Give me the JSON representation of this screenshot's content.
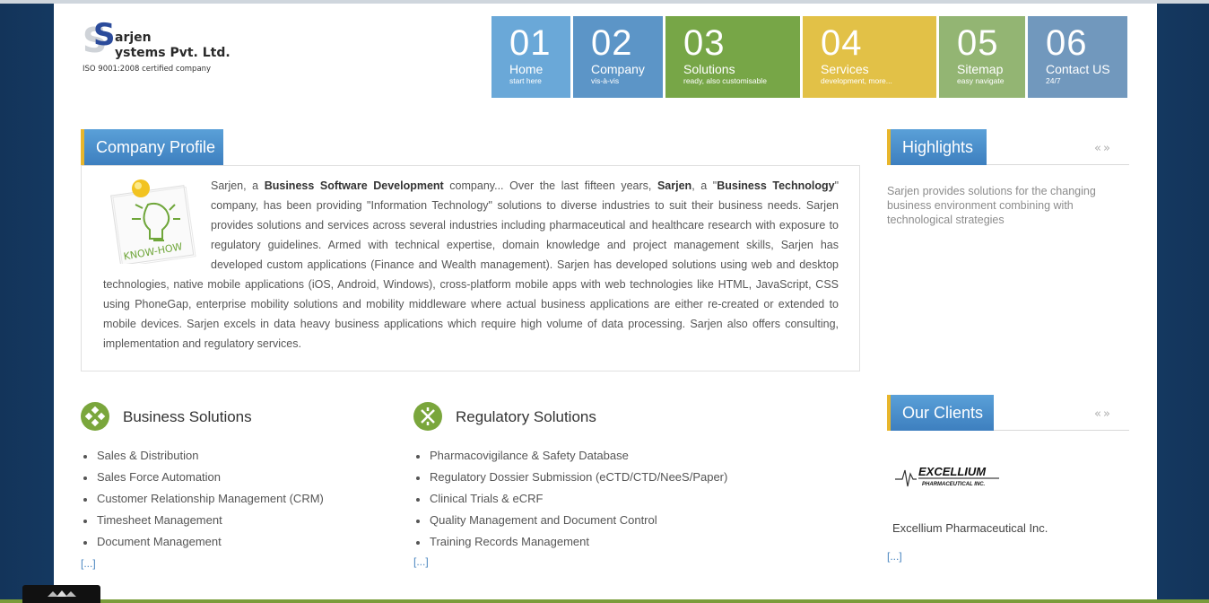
{
  "logo": {
    "name_line1": "arjen",
    "name_line2": "ystems Pvt. Ltd.",
    "tagline": "ISO 9001:2008 certified company"
  },
  "nav": [
    {
      "num": "01",
      "label": "Home",
      "sub": "start here",
      "color": "#6aa8d8"
    },
    {
      "num": "02",
      "label": "Company",
      "sub": "vis-à-vis",
      "color": "#5c95c7"
    },
    {
      "num": "03",
      "label": "Solutions",
      "sub": "ready, also customisable",
      "color": "#77a647"
    },
    {
      "num": "04",
      "label": "Services",
      "sub": "development, more...",
      "color": "#e2c147"
    },
    {
      "num": "05",
      "label": "Sitemap",
      "sub": "easy navigate",
      "color": "#93b573"
    },
    {
      "num": "06",
      "label": "Contact US",
      "sub": "24/7",
      "color": "#7198bd"
    }
  ],
  "profile": {
    "heading": "Company Profile",
    "image_label": "KNOW-HOW",
    "p1": "Sarjen, a ",
    "b1": "Business Software Development",
    "p2": " company... Over the last fifteen years, ",
    "b2": "Sarjen",
    "p3": ", a \"",
    "b3": "Business Technology",
    "p4": "\" company, has been providing \"Information Technology\" solutions to diverse industries to suit their business needs. Sarjen provides solutions and services across several industries including pharmaceutical and healthcare research with exposure to regulatory guidelines. Armed with technical expertise, domain knowledge and project management skills, Sarjen has developed custom applications (Finance and Wealth management). Sarjen has developed solutions using web and desktop technologies, native mobile applications (iOS, Android, Windows), cross-platform mobile apps with web technologies like HTML, JavaScript, CSS using PhoneGap, enterprise mobility solutions and mobility middleware where actual business applications are either re-created or extended to mobile devices. Sarjen excels in data heavy business applications which require high volume of data processing. Sarjen also offers consulting, implementation and regulatory services."
  },
  "highlights": {
    "heading": "Highlights",
    "text": "Sarjen provides solutions for the changing business environment combining with technological strategies",
    "arrows": "«»"
  },
  "business": {
    "title": "Business Solutions",
    "items": [
      "Sales & Distribution",
      "Sales Force Automation",
      "Customer Relationship Management (CRM)",
      "Timesheet Management",
      "Document Management"
    ],
    "more": "[...]"
  },
  "regulatory": {
    "title": "Regulatory Solutions",
    "items": [
      "Pharmacovigilance & Safety Database",
      "Regulatory Dossier Submission (eCTD/CTD/NeeS/Paper)",
      "Clinical Trials & eCRF",
      "Quality Management and Document Control",
      "Training Records Management"
    ],
    "more": "[...]"
  },
  "clients": {
    "heading": "Our Clients",
    "logo_text": "EXCELLIUM",
    "logo_sub": "PHARMACEUTICAL INC.",
    "name": "Excellium Pharmaceutical Inc.",
    "more": "[...]",
    "arrows": "«»"
  },
  "colors": {
    "accent": "#3d7fbf",
    "highlight_bar": "#e8b62c",
    "solution_icon": "#7aa63c"
  }
}
